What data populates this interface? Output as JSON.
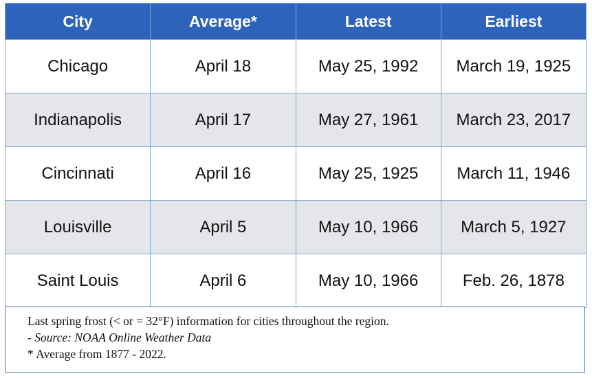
{
  "table": {
    "headers": [
      "City",
      "Average*",
      "Latest",
      "Earliest"
    ],
    "rows": [
      {
        "city": "Chicago",
        "average": "April 18",
        "latest": "May 25, 1992",
        "earliest": "March 19, 1925"
      },
      {
        "city": "Indianapolis",
        "average": "April 17",
        "latest": "May 27, 1961",
        "earliest": "March 23, 2017"
      },
      {
        "city": "Cincinnati",
        "average": "April 16",
        "latest": "May 25, 1925",
        "earliest": "March 11, 1946"
      },
      {
        "city": "Louisville",
        "average": "April 5",
        "latest": "May 10, 1966",
        "earliest": "March 5, 1927"
      },
      {
        "city": "Saint Louis",
        "average": "April 6",
        "latest": "May 10, 1966",
        "earliest": "Feb. 26, 1878"
      }
    ]
  },
  "note": {
    "line1": "Last spring frost (< or = 32°F) information for cities throughout the region.",
    "source_prefix": "- ",
    "source": "Source: NOAA Online Weather Data",
    "line3": "* Average from 1877 - 2022."
  },
  "colors": {
    "header_bg": "#2d63bb",
    "alt_row_bg": "#e4e6ea",
    "border": "#7ea7d4"
  }
}
